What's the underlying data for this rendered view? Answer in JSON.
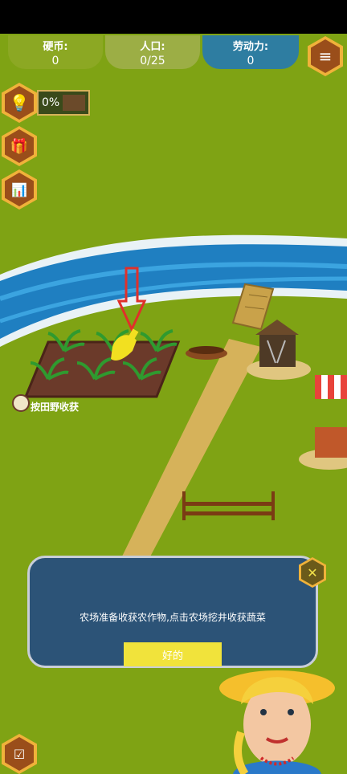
{
  "stats": [
    {
      "label": "硬币:",
      "value": "0"
    },
    {
      "label": "人口:",
      "value": "0/25"
    },
    {
      "label": "劳动力:",
      "value": "0"
    }
  ],
  "progress": {
    "text": "0%"
  },
  "field_hint": "按田野收获",
  "dialog": {
    "message": "农场准备收获农作物,点击农场挖井收获蔬菜",
    "ok_label": "好的"
  },
  "icons": [
    "menu-icon",
    "lightbulb-icon",
    "gift-icon",
    "chart-icon",
    "close-icon",
    "tasks-icon",
    "hand-pointer-icon",
    "arrow-down-icon"
  ],
  "colors": {
    "grass": "#7fa314",
    "river": "#1f7fc1",
    "path": "#d6b25a",
    "dialog": "#2c5377",
    "button": "#f1e33b",
    "hex": "#f0b23a"
  }
}
